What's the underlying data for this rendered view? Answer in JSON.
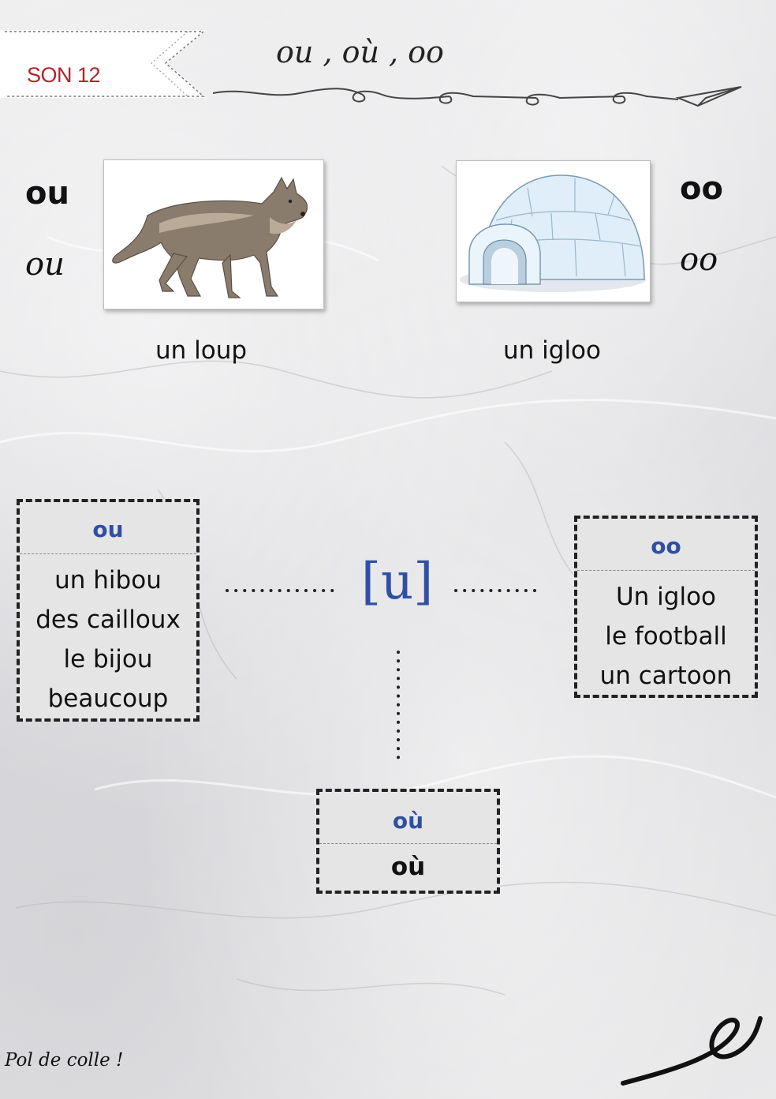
{
  "header": {
    "son_label": "SON 12",
    "title": "ou , où , oo"
  },
  "left_spelling": {
    "print": "ou",
    "cursive": "ou",
    "caption": "un loup",
    "image_icon": "wolf-illustration"
  },
  "right_spelling": {
    "print": "oo",
    "cursive": "oo",
    "caption": "un igloo",
    "image_icon": "igloo-illustration"
  },
  "phoneme": "[u]",
  "boxes": {
    "ou": {
      "heading": "ou",
      "words": [
        "un hibou",
        "des cailloux",
        "le bijou",
        "beaucoup"
      ]
    },
    "oo": {
      "heading": "oo",
      "words": [
        "Un igloo",
        "le football",
        "un cartoon"
      ]
    },
    "ou_accent": {
      "heading": "où",
      "words": [
        "où"
      ]
    }
  },
  "footer": {
    "text": "Pol de colle !"
  },
  "colors": {
    "accent_red": "#b0252c",
    "accent_blue": "#2f4fa2"
  }
}
